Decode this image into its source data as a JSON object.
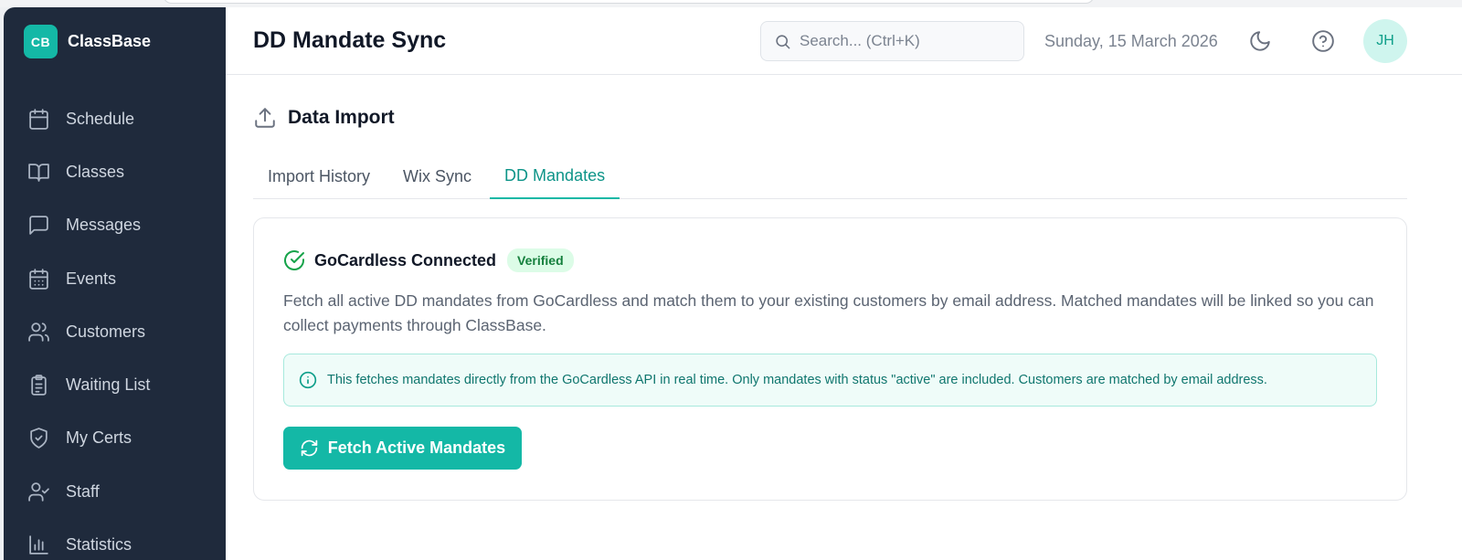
{
  "app": {
    "logo_text": "CB",
    "name": "ClassBase"
  },
  "sidebar": {
    "items": [
      {
        "label": "Schedule",
        "icon": "calendar-icon"
      },
      {
        "label": "Classes",
        "icon": "book-open-icon"
      },
      {
        "label": "Messages",
        "icon": "message-square-icon"
      },
      {
        "label": "Events",
        "icon": "calendar-days-icon"
      },
      {
        "label": "Customers",
        "icon": "users-icon"
      },
      {
        "label": "Waiting List",
        "icon": "clipboard-list-icon"
      },
      {
        "label": "My Certs",
        "icon": "shield-check-icon"
      },
      {
        "label": "Staff",
        "icon": "user-check-icon"
      },
      {
        "label": "Statistics",
        "icon": "bar-chart-icon"
      }
    ]
  },
  "header": {
    "title": "DD Mandate Sync",
    "search_placeholder": "Search... (Ctrl+K)",
    "date": "Sunday, 15 March 2026",
    "avatar_initials": "JH"
  },
  "section": {
    "title": "Data Import"
  },
  "tabs": [
    {
      "label": "Import History",
      "active": false
    },
    {
      "label": "Wix Sync",
      "active": false
    },
    {
      "label": "DD Mandates",
      "active": true
    }
  ],
  "card": {
    "connection_title": "GoCardless Connected",
    "badge": "Verified",
    "description": "Fetch all active DD mandates from GoCardless and match them to your existing customers by email address. Matched mandates will be linked so you can collect payments through ClassBase.",
    "info": "This fetches mandates directly from the GoCardless API in real time. Only mandates with status \"active\" are included. Customers are matched by email address.",
    "button_label": "Fetch Active Mandates"
  },
  "colors": {
    "accent": "#14b8a6",
    "sidebar_bg": "#1f2a3c",
    "success": "#16a34a"
  }
}
